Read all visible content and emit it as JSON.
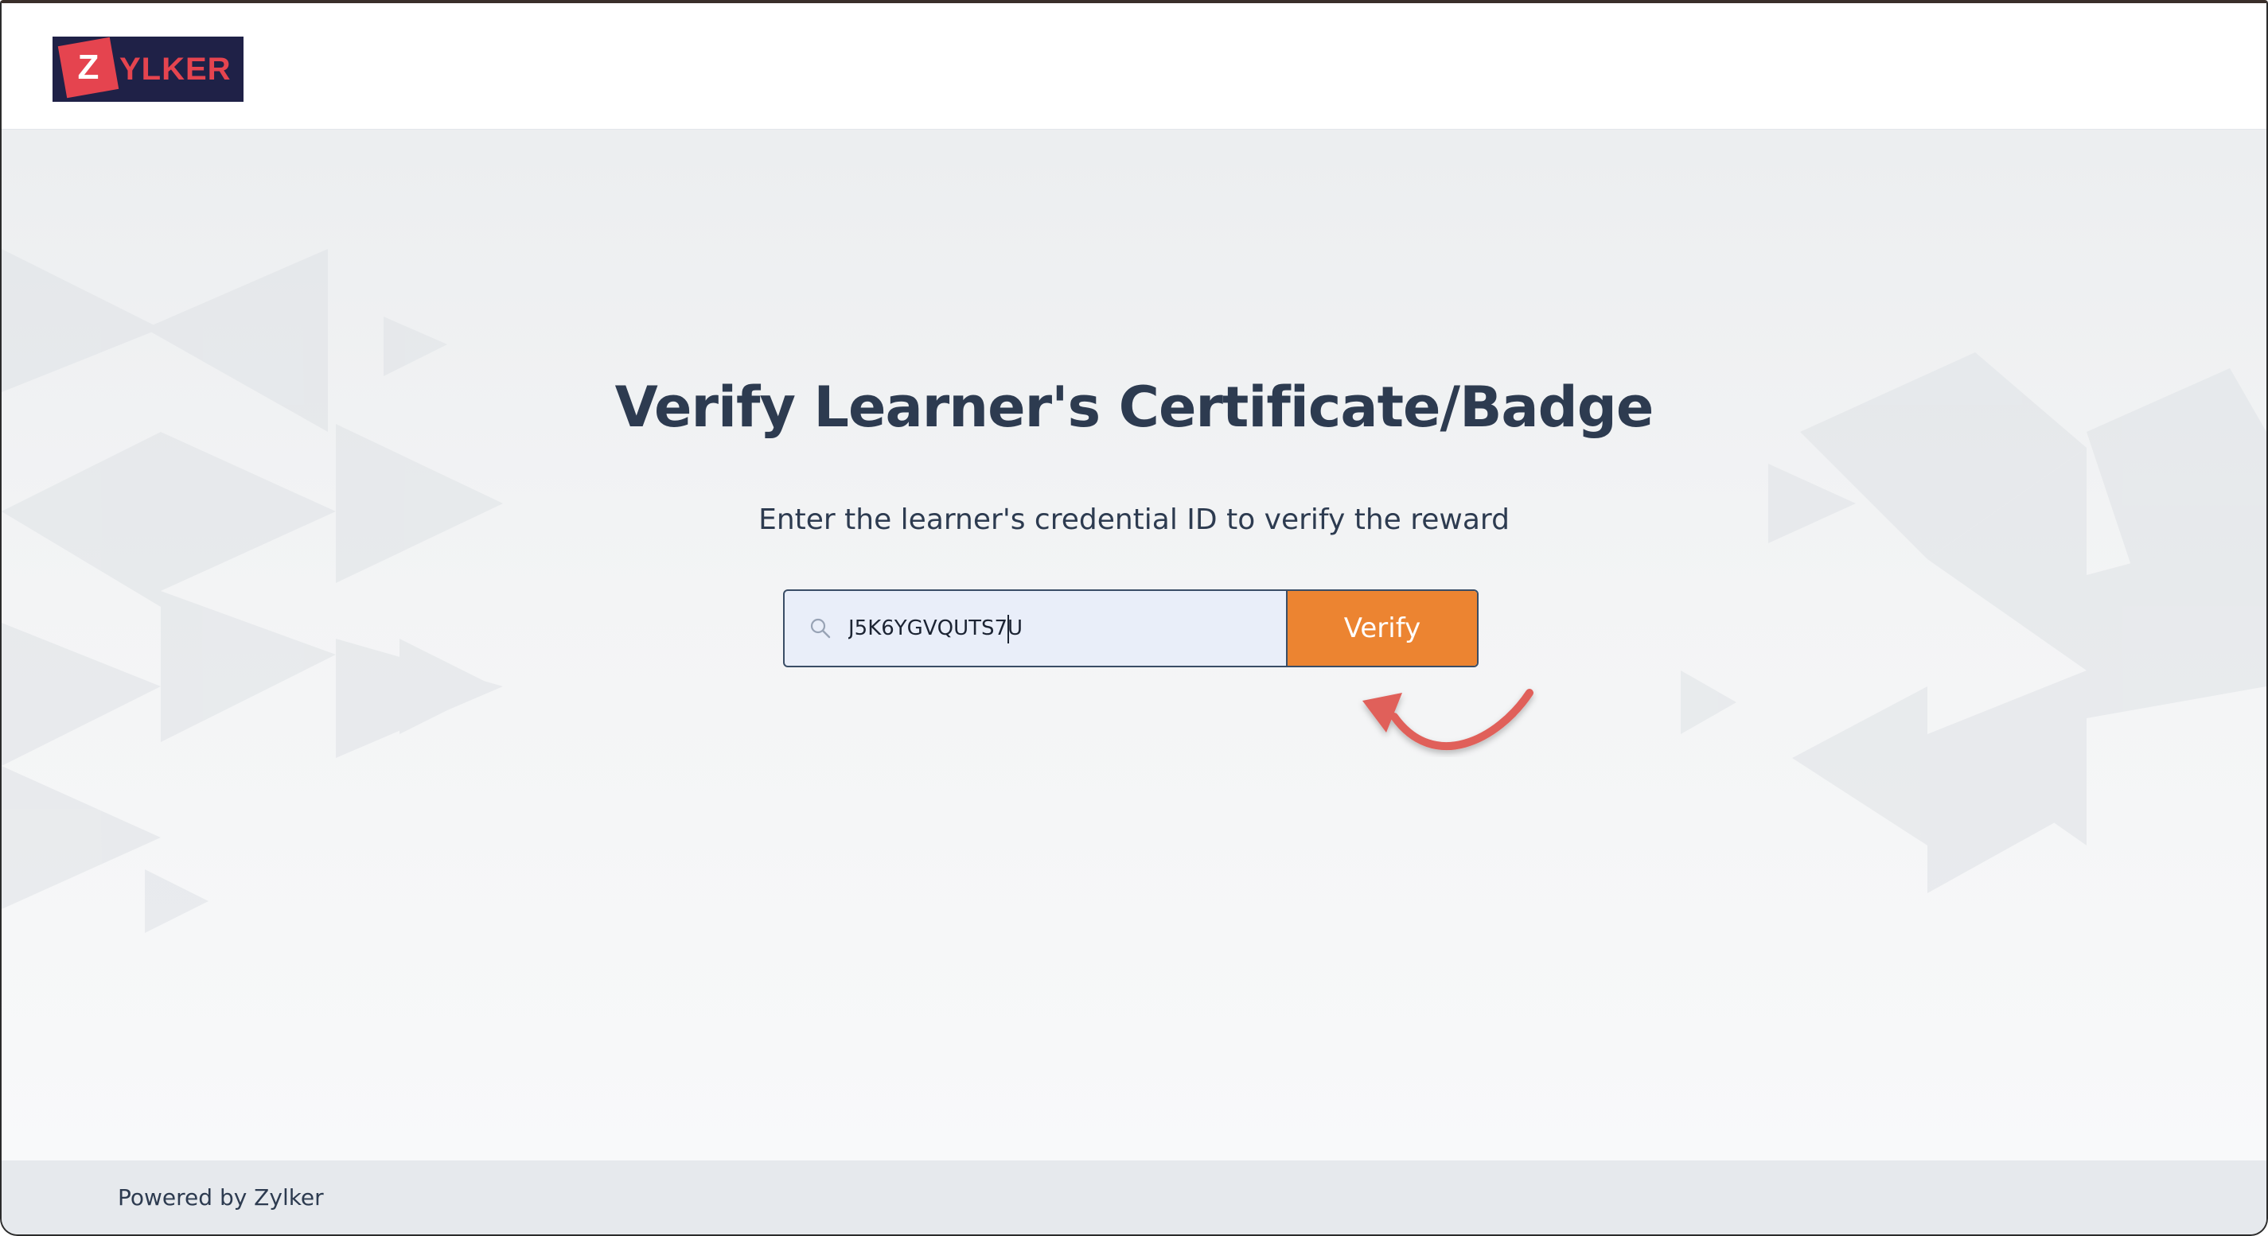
{
  "header": {
    "logo_letter": "Z",
    "logo_rest": "YLKER"
  },
  "main": {
    "title": "Verify Learner's Certificate/Badge",
    "subtitle": "Enter the learner's credential ID to verify the reward",
    "search": {
      "value": "J5K6YGVQUTS7U",
      "icon": "search-icon"
    },
    "verify_label": "Verify"
  },
  "footer": {
    "text": "Powered by Zylker"
  },
  "colors": {
    "brand_red": "#e5444f",
    "brand_navy": "#1f2147",
    "button_orange": "#ec8431",
    "text_dark": "#2d3b50",
    "input_bg": "#e9eef9",
    "annotation_arrow": "#e0605a"
  }
}
